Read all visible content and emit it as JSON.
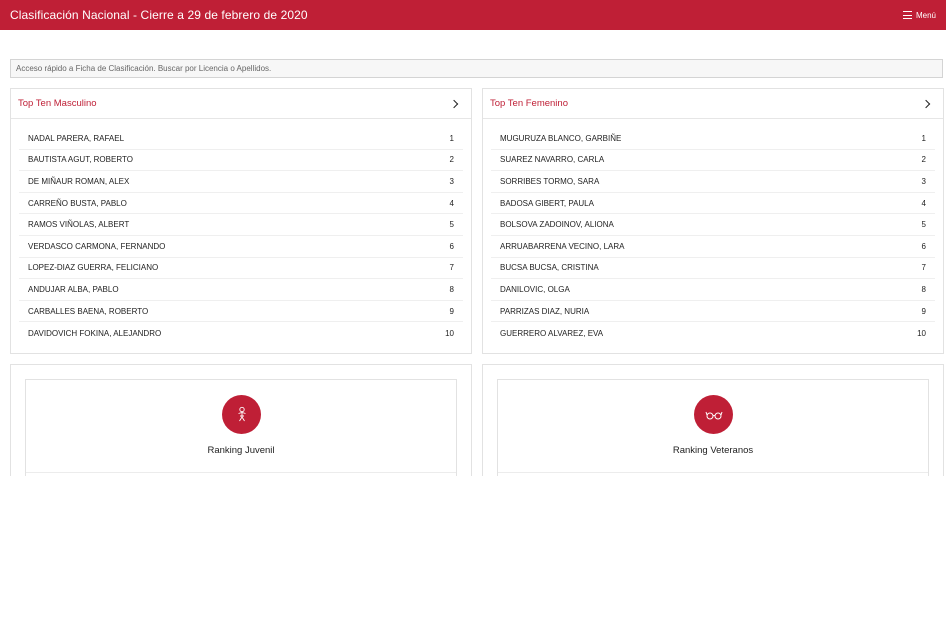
{
  "header": {
    "title": "Clasificación Nacional - Cierre a 29 de febrero de 2020",
    "menu_label": "Menú",
    "menu_icon": "hamburger-icon"
  },
  "search": {
    "placeholder": "Acceso rápido a Ficha de Clasificación. Buscar por Licencia o Apellidos."
  },
  "top_masculino": {
    "title": "Top Ten Masculino",
    "rows": [
      {
        "name": "NADAL PARERA, RAFAEL",
        "rank": "1"
      },
      {
        "name": "BAUTISTA AGUT, ROBERTO",
        "rank": "2"
      },
      {
        "name": "DE MIÑAUR ROMAN, ALEX",
        "rank": "3"
      },
      {
        "name": "CARREÑO BUSTA, PABLO",
        "rank": "4"
      },
      {
        "name": "RAMOS VIÑOLAS, ALBERT",
        "rank": "5"
      },
      {
        "name": "VERDASCO CARMONA, FERNANDO",
        "rank": "6"
      },
      {
        "name": "LOPEZ-DIAZ GUERRA, FELICIANO",
        "rank": "7"
      },
      {
        "name": "ANDUJAR ALBA, PABLO",
        "rank": "8"
      },
      {
        "name": "CARBALLES BAENA, ROBERTO",
        "rank": "9"
      },
      {
        "name": "DAVIDOVICH FOKINA, ALEJANDRO",
        "rank": "10"
      }
    ]
  },
  "top_femenino": {
    "title": "Top Ten Femenino",
    "rows": [
      {
        "name": "MUGURUZA BLANCO, GARBIÑE",
        "rank": "1"
      },
      {
        "name": "SUAREZ NAVARRO, CARLA",
        "rank": "2"
      },
      {
        "name": "SORRIBES TORMO, SARA",
        "rank": "3"
      },
      {
        "name": "BADOSA GIBERT, PAULA",
        "rank": "4"
      },
      {
        "name": "BOLSOVA ZADOINOV, ALIONA",
        "rank": "5"
      },
      {
        "name": "ARRUABARRENA VECINO, LARA",
        "rank": "6"
      },
      {
        "name": "BUCSA BUCSA, CRISTINA",
        "rank": "7"
      },
      {
        "name": "DANILOVIC, OLGA",
        "rank": "8"
      },
      {
        "name": "PARRIZAS DIAZ, NURIA",
        "rank": "9"
      },
      {
        "name": "GUERRERO ALVAREZ, EVA",
        "rank": "10"
      }
    ]
  },
  "cards": {
    "juvenil": {
      "label": "Ranking Juvenil",
      "icon": "child-icon"
    },
    "veteranos": {
      "label": "Ranking Veteranos",
      "icon": "glasses-icon"
    }
  },
  "colors": {
    "accent": "#bf1f36"
  }
}
